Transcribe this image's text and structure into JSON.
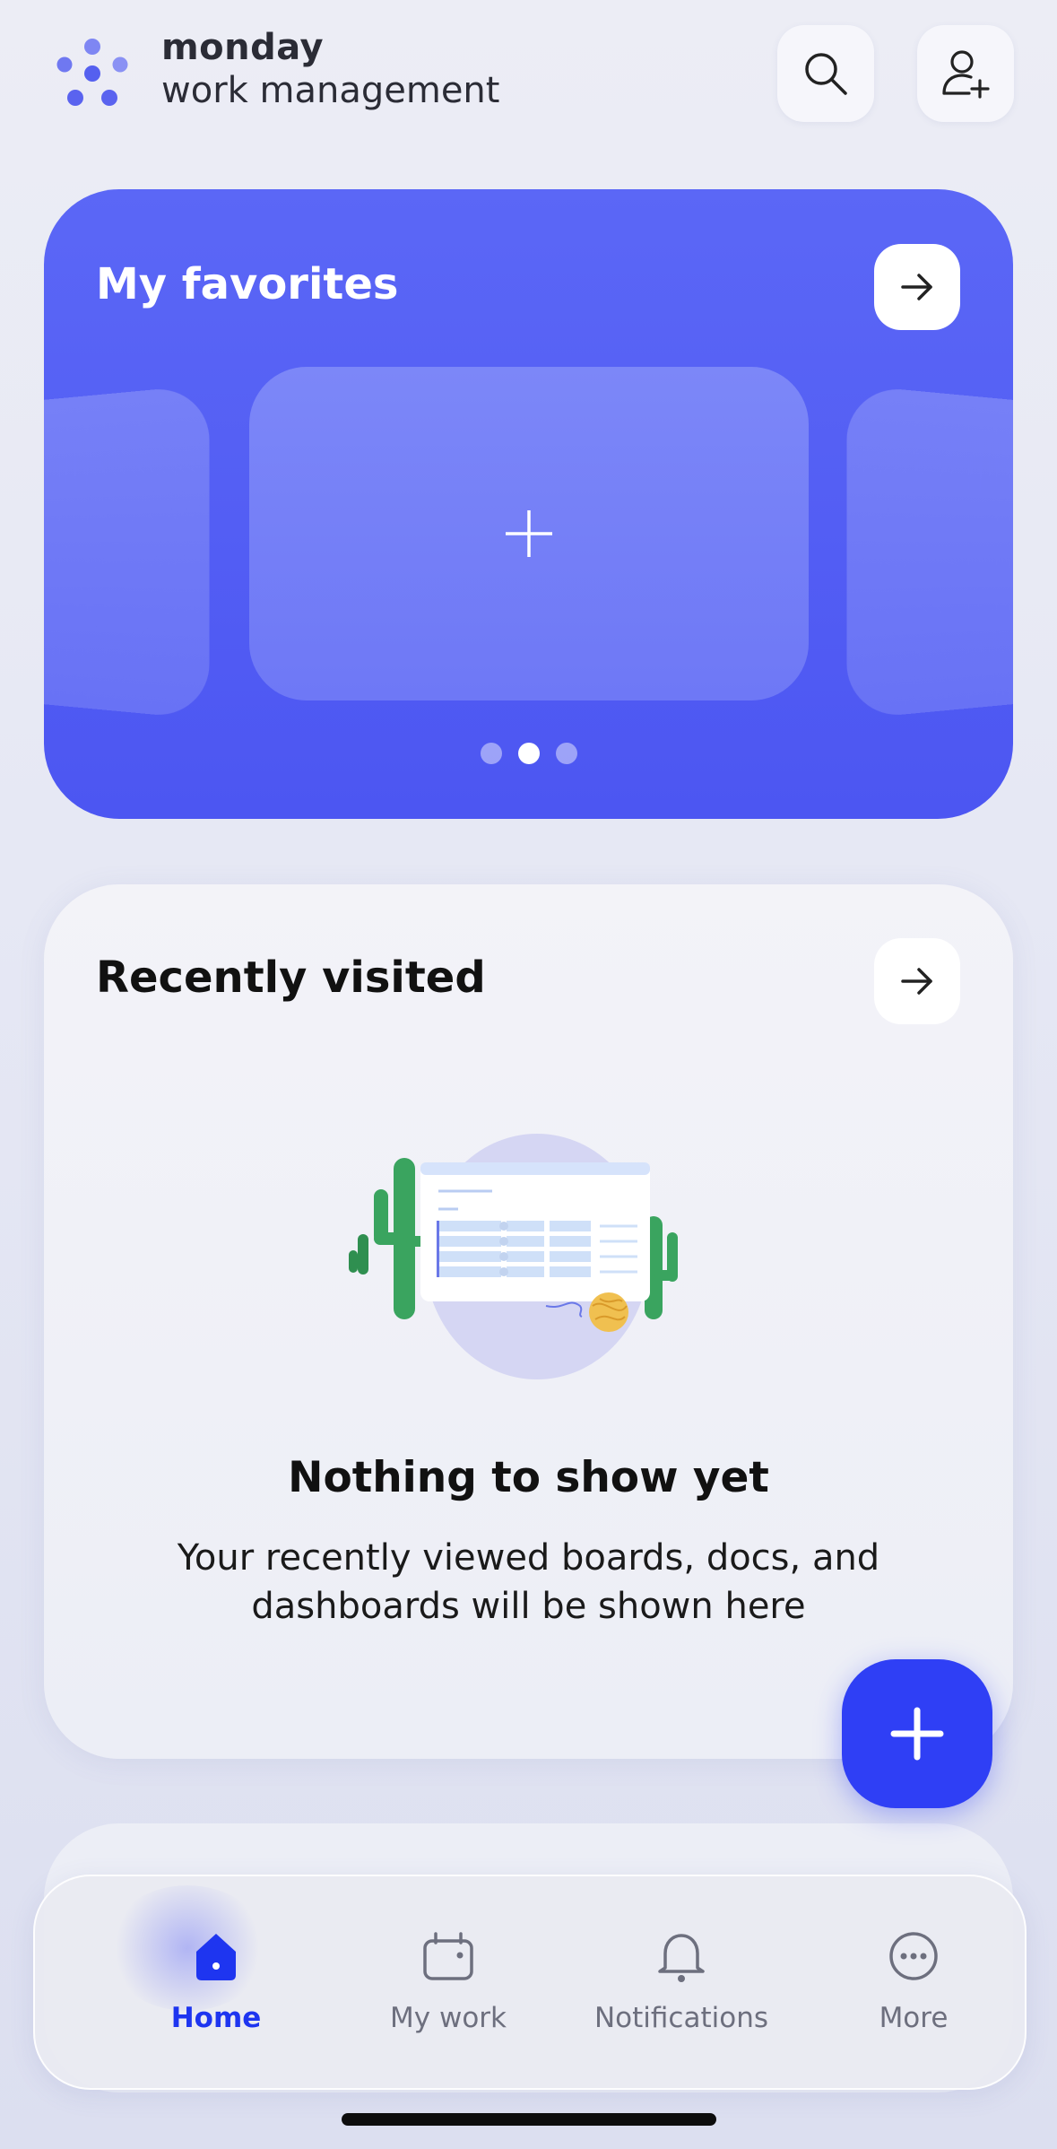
{
  "header": {
    "brand_name": "monday",
    "brand_subtitle": "work management",
    "search_icon": "search-icon",
    "invite_icon": "person-add-icon"
  },
  "favorites": {
    "title": "My favorites",
    "add_icon": "plus-icon",
    "carousel": {
      "pages": 3,
      "active_page": 2
    }
  },
  "recently_visited": {
    "title": "Recently visited",
    "empty_title": "Nothing to show yet",
    "empty_message": "Your recently viewed boards, docs, and dashboards will be shown here"
  },
  "fab": {
    "icon": "plus-icon"
  },
  "tabbar": {
    "tabs": [
      {
        "label": "Home",
        "icon": "home-icon",
        "active": true
      },
      {
        "label": "My work",
        "icon": "calendar-icon",
        "active": false
      },
      {
        "label": "Notifications",
        "icon": "bell-icon",
        "active": false
      },
      {
        "label": "More",
        "icon": "more-icon",
        "active": false
      }
    ]
  },
  "colors": {
    "accent": "#2f3ff5",
    "favorites_bg": "#5560f4",
    "active_tab": "#1e35f0"
  }
}
